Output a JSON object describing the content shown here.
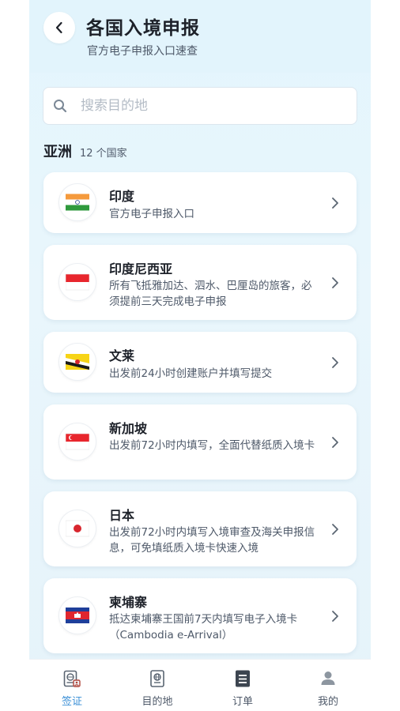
{
  "header": {
    "title": "各国入境申报",
    "subtitle": "官方电子申报入口速查"
  },
  "search": {
    "placeholder": "搜索目的地",
    "value": ""
  },
  "section": {
    "title": "亚洲",
    "count": "12 个国家"
  },
  "countries": [
    {
      "name": "印度",
      "desc": "官方电子申报入口",
      "flag": "india-flag"
    },
    {
      "name": "印度尼西亚",
      "desc": "所有飞抵雅加达、泗水、巴厘岛的旅客，必须提前三天完成电子申报",
      "flag": "indonesia-flag"
    },
    {
      "name": "文莱",
      "desc": "出发前24小时创建账户并填写提交",
      "flag": "brunei-flag"
    },
    {
      "name": "新加坡",
      "desc": "出发前72小时内填写，全面代替纸质入境卡",
      "flag": "singapore-flag"
    },
    {
      "name": "日本",
      "desc": "出发前72小时内填写入境审查及海关申报信息，可免填纸质入境卡快速入境",
      "flag": "japan-flag"
    },
    {
      "name": "柬埔寨",
      "desc": "抵达柬埔寨王国前7天内填写电子入境卡（Cambodia e-Arrival）",
      "flag": "cambodia-flag"
    }
  ],
  "nav": [
    {
      "label": "签证",
      "icon": "visa-icon",
      "active": true
    },
    {
      "label": "目的地",
      "icon": "passport-icon",
      "active": false
    },
    {
      "label": "订单",
      "icon": "order-icon",
      "active": false
    },
    {
      "label": "我的",
      "icon": "user-icon",
      "active": false
    }
  ],
  "colors": {
    "accent": "#3a8fd6",
    "background": "#e3f5fd",
    "card": "#ffffff"
  }
}
